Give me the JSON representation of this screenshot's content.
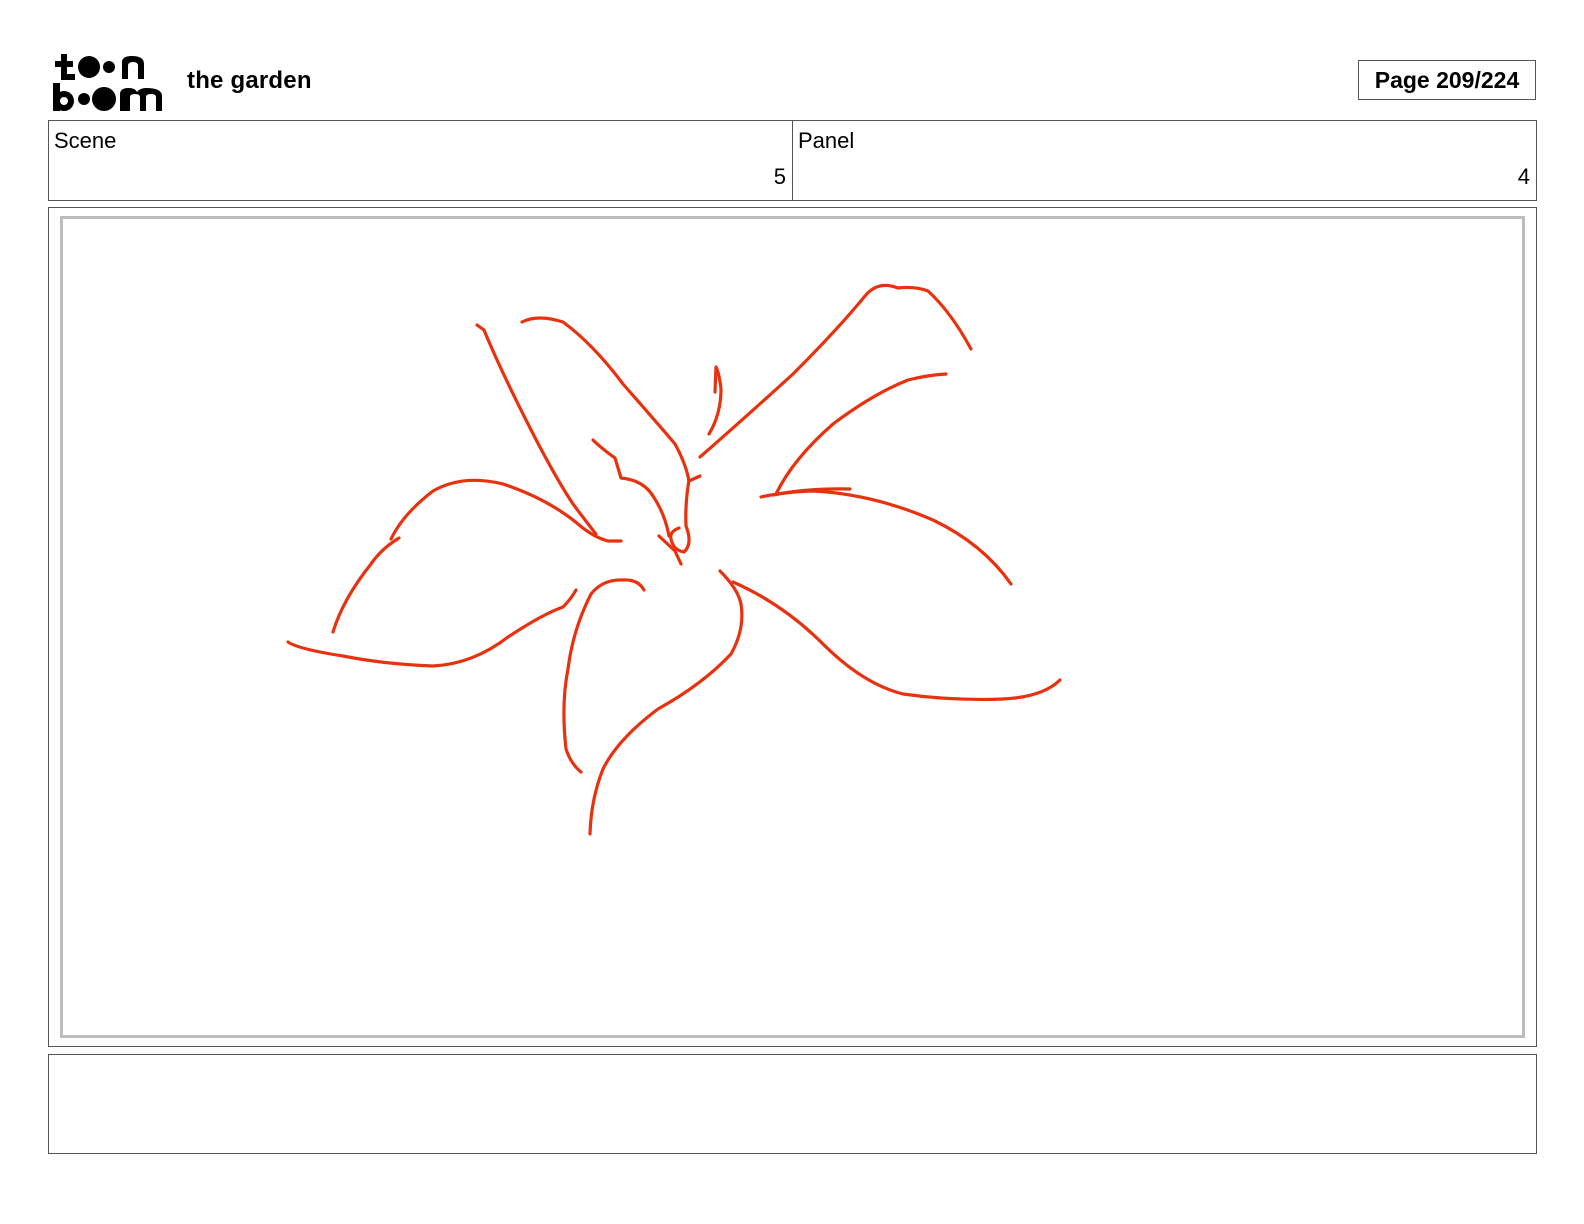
{
  "header": {
    "logo_text": "toon boom",
    "project_title": "the garden",
    "page_label": "Page 209/224"
  },
  "info": {
    "scene_label": "Scene",
    "scene_value": "5",
    "panel_label": "Panel",
    "panel_value": "4"
  },
  "drawing": {
    "subject": "flower-sketch",
    "stroke_color": "#e8320f"
  },
  "notes": {
    "text": ""
  }
}
